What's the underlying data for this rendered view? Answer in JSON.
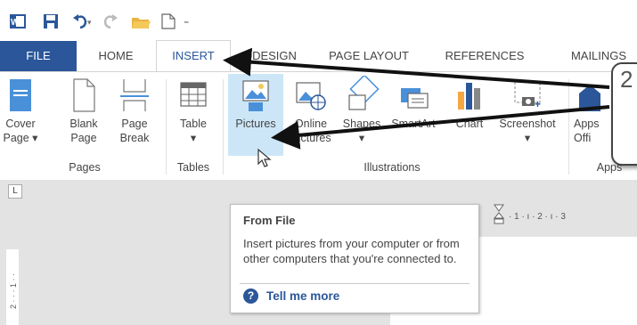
{
  "qat": {
    "icons": [
      "word-app-icon",
      "save-icon",
      "undo-icon",
      "redo-icon",
      "open-folder-icon",
      "new-document-icon",
      "customize-qat-icon"
    ]
  },
  "tabs": [
    {
      "label": "FILE"
    },
    {
      "label": "HOME"
    },
    {
      "label": "INSERT"
    },
    {
      "label": "DESIGN"
    },
    {
      "label": "PAGE LAYOUT"
    },
    {
      "label": "REFERENCES"
    },
    {
      "label": "MAILINGS"
    }
  ],
  "ribbon": {
    "cover_page": {
      "line1": "Cover",
      "line2": "Page ▾"
    },
    "blank_page": {
      "line1": "Blank",
      "line2": "Page"
    },
    "page_break": {
      "line1": "Page",
      "line2": "Break"
    },
    "table": {
      "line1": "Table",
      "line2": "▾"
    },
    "pictures": {
      "line1": "Pictures"
    },
    "online_pictures": {
      "line1": "Online",
      "line2": "Pictures"
    },
    "shapes": {
      "line1": "Shapes",
      "line2": "▾"
    },
    "smartart": {
      "line1": "SmartArt"
    },
    "chart": {
      "line1": "Chart"
    },
    "screenshot": {
      "line1": "Screenshot",
      "line2": "▾"
    },
    "apps": {
      "line1": "Apps",
      "line2": "Offi"
    },
    "groups": {
      "pages": "Pages",
      "tables": "Tables",
      "illustrations": "Illustrations",
      "apps": "Apps"
    }
  },
  "tooltip": {
    "title": "From File",
    "body": "Insert pictures from your computer or from other computers that you're connected to.",
    "more": "Tell me more",
    "help_glyph": "?"
  },
  "callout": {
    "number": "2"
  },
  "ruler": {
    "corner": "L",
    "top_text": "· 1 · ı · 2 · ı · 3",
    "left_text": "2 · · · 1 · ·"
  },
  "colors": {
    "accent": "#2b579a",
    "tab_file_bg": "#2b579a",
    "hover_bg": "#cde6f7"
  }
}
